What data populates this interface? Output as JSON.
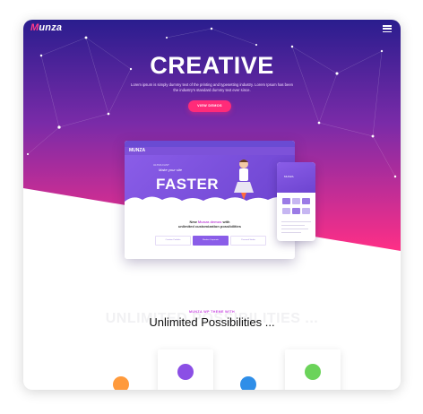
{
  "header": {
    "logo_first": "M",
    "logo_rest": "unza"
  },
  "hero": {
    "title": "CREATIVE",
    "description": "Lorem ipsum is simply dummy text of the printing and typesetting industry. Lorem Ipsum has been the industry's standard dummy text ever since.",
    "cta_label": "VIEW DEMOS"
  },
  "laptop": {
    "nav_logo": "MUNZA",
    "hero_small": "ULTRA FAST",
    "hero_tagline": "Make your site",
    "hero_heading": "FASTER",
    "headline_line1_a": "New ",
    "headline_line1_b": "Munza demos",
    "headline_line1_c": " with",
    "headline_line2": "unlimited customization possibilities",
    "buttons": [
      "Creative Portfolio",
      "Modern Corporate",
      "Personal Studio"
    ]
  },
  "phone": {
    "hero_text": "MUNZA"
  },
  "section": {
    "kicker": "MUNZA WP THEME WITH",
    "background_text": "UNLIMITED POSSIBILITIES ...",
    "title": "Unlimited Possibilities ..."
  },
  "colors": {
    "accent": "#ff2b79",
    "gradient_top": "#2a1d8e",
    "gradient_bottom": "#ff2f86",
    "feature_icons": [
      "#ff9a3c",
      "#8b4fe5",
      "#2f8ee8",
      "#6bd35a"
    ]
  }
}
